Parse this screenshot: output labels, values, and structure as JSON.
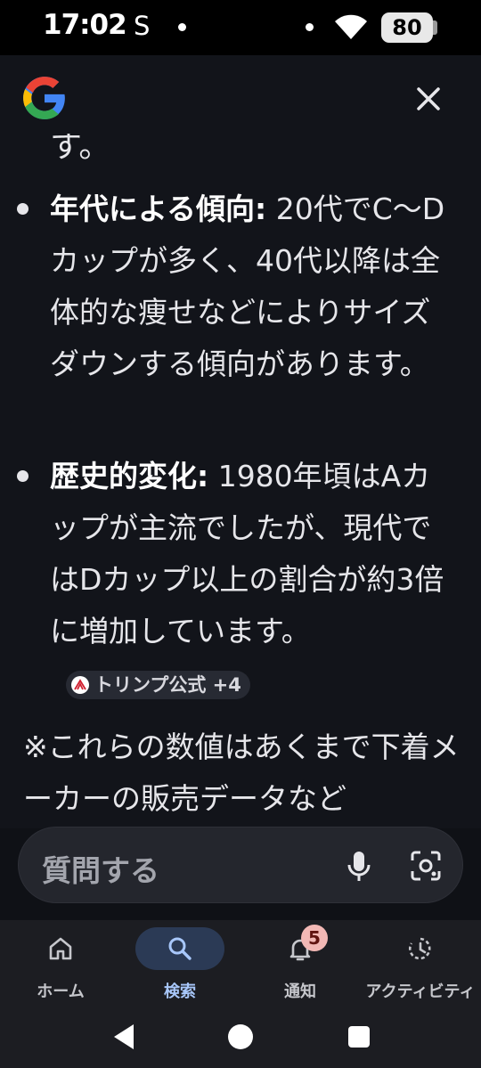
{
  "status_bar": {
    "time": "17:02",
    "carrier_icon": "S",
    "battery": "80"
  },
  "header": {
    "logo": "google-logo",
    "close_label": "close"
  },
  "content": {
    "fragment": "す。",
    "items": [
      {
        "heading": "年代による傾向:",
        "body": " 20代でC〜Dカップが多く、40代以降は全体的な痩せなどによりサイズダウンする傾向があります。"
      },
      {
        "heading": "歴史的変化:",
        "body": " 1980年頃はAカップが主流でしたが、現代ではDカップ以上の割合が約3倍に増加しています。",
        "source_chip": "トリンプ公式 +4"
      }
    ],
    "note": "※これらの数値はあくまで下着メーカーの販売データなど"
  },
  "ask_bar": {
    "placeholder": "質問する"
  },
  "bottom_nav": {
    "items": [
      {
        "label": "ホーム",
        "icon": "home-icon"
      },
      {
        "label": "検索",
        "icon": "search-icon",
        "active": true
      },
      {
        "label": "通知",
        "icon": "bell-icon",
        "badge": "5"
      },
      {
        "label": "アクティビティ",
        "icon": "activity-icon"
      }
    ]
  },
  "colors": {
    "background": "#12141a",
    "active_nav": "#a8c7fa",
    "badge_bg": "#f2b8b5"
  }
}
